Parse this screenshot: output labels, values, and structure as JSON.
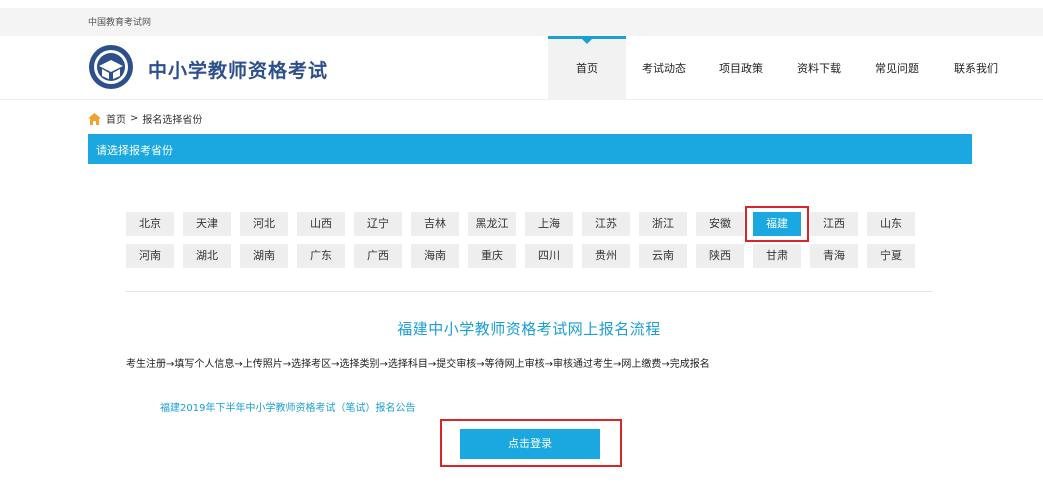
{
  "topbar": {
    "text": "中国教育考试网"
  },
  "header": {
    "site_title": "中小学教师资格考试",
    "logo_icon": "exam-logo-icon"
  },
  "nav": {
    "items": [
      {
        "label": "首页",
        "active": true
      },
      {
        "label": "考试动态",
        "active": false
      },
      {
        "label": "项目政策",
        "active": false
      },
      {
        "label": "资料下载",
        "active": false
      },
      {
        "label": "常见问题",
        "active": false
      },
      {
        "label": "联系我们",
        "active": false
      }
    ]
  },
  "breadcrumb": {
    "home": "首页",
    "separator": ">",
    "current": "报名选择省份"
  },
  "section": {
    "title": "请选择报考省份"
  },
  "provinces": {
    "row1": [
      "北京",
      "天津",
      "河北",
      "山西",
      "辽宁",
      "吉林",
      "黑龙江",
      "上海",
      "江苏",
      "浙江",
      "安徽",
      "福建",
      "江西",
      "山东"
    ],
    "row2": [
      "河南",
      "湖北",
      "湖南",
      "广东",
      "广西",
      "海南",
      "重庆",
      "四川",
      "贵州",
      "云南",
      "陕西",
      "甘肃",
      "青海",
      "宁夏"
    ],
    "selected": "福建"
  },
  "flow": {
    "title": "福建中小学教师资格考试网上报名流程",
    "steps": "考生注册→填写个人信息→上传照片→选择考区→选择类别→选择科目→提交审核→等待网上审核→审核通过考生→网上缴费→完成报名"
  },
  "notice": {
    "link": "福建2019年下半年中小学教师资格考试（笔试）报名公告"
  },
  "login": {
    "label": "点击登录"
  },
  "colors": {
    "accent": "#1ba8e0",
    "highlight": "#d9252a",
    "title": "#2d4f8c"
  }
}
